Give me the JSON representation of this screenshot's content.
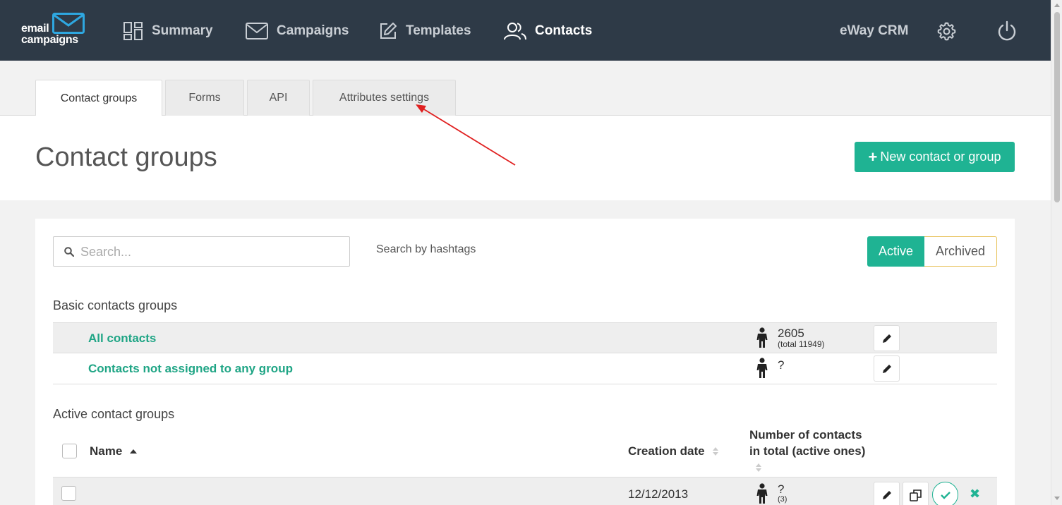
{
  "logo": {
    "line1": "email",
    "line2": "campaigns"
  },
  "nav": {
    "items": [
      {
        "label": "Summary",
        "icon": "dashboard-icon"
      },
      {
        "label": "Campaigns",
        "icon": "envelope-icon"
      },
      {
        "label": "Templates",
        "icon": "edit-icon"
      },
      {
        "label": "Contacts",
        "icon": "users-icon",
        "active": true
      }
    ],
    "crm_label": "eWay CRM"
  },
  "tabs": [
    {
      "label": "Contact groups",
      "active": true
    },
    {
      "label": "Forms"
    },
    {
      "label": "API"
    },
    {
      "label": "Attributes settings"
    }
  ],
  "page": {
    "title": "Contact groups",
    "new_button": "New contact or group"
  },
  "filters": {
    "search_placeholder": "Search...",
    "hashtags_label": "Search by hashtags",
    "toggle_active": "Active",
    "toggle_archived": "Archived"
  },
  "basic": {
    "heading": "Basic contacts groups",
    "rows": [
      {
        "name": "All contacts",
        "count": "2605",
        "count_sub": "(total 11949)"
      },
      {
        "name": "Contacts not assigned to any group",
        "count": "?",
        "count_sub": ""
      }
    ]
  },
  "active": {
    "heading": "Active contact groups",
    "columns": {
      "name": "Name",
      "creation_date": "Creation date",
      "contacts_line1": "Number of contacts",
      "contacts_line2": "in total (active ones)"
    },
    "rows": [
      {
        "name": "",
        "date": "12/12/2013",
        "count": "?",
        "count_sub": "(3)"
      }
    ]
  },
  "colors": {
    "accent": "#1fb393",
    "nav_bg": "#2e3a47",
    "annotation": "#e02020"
  }
}
